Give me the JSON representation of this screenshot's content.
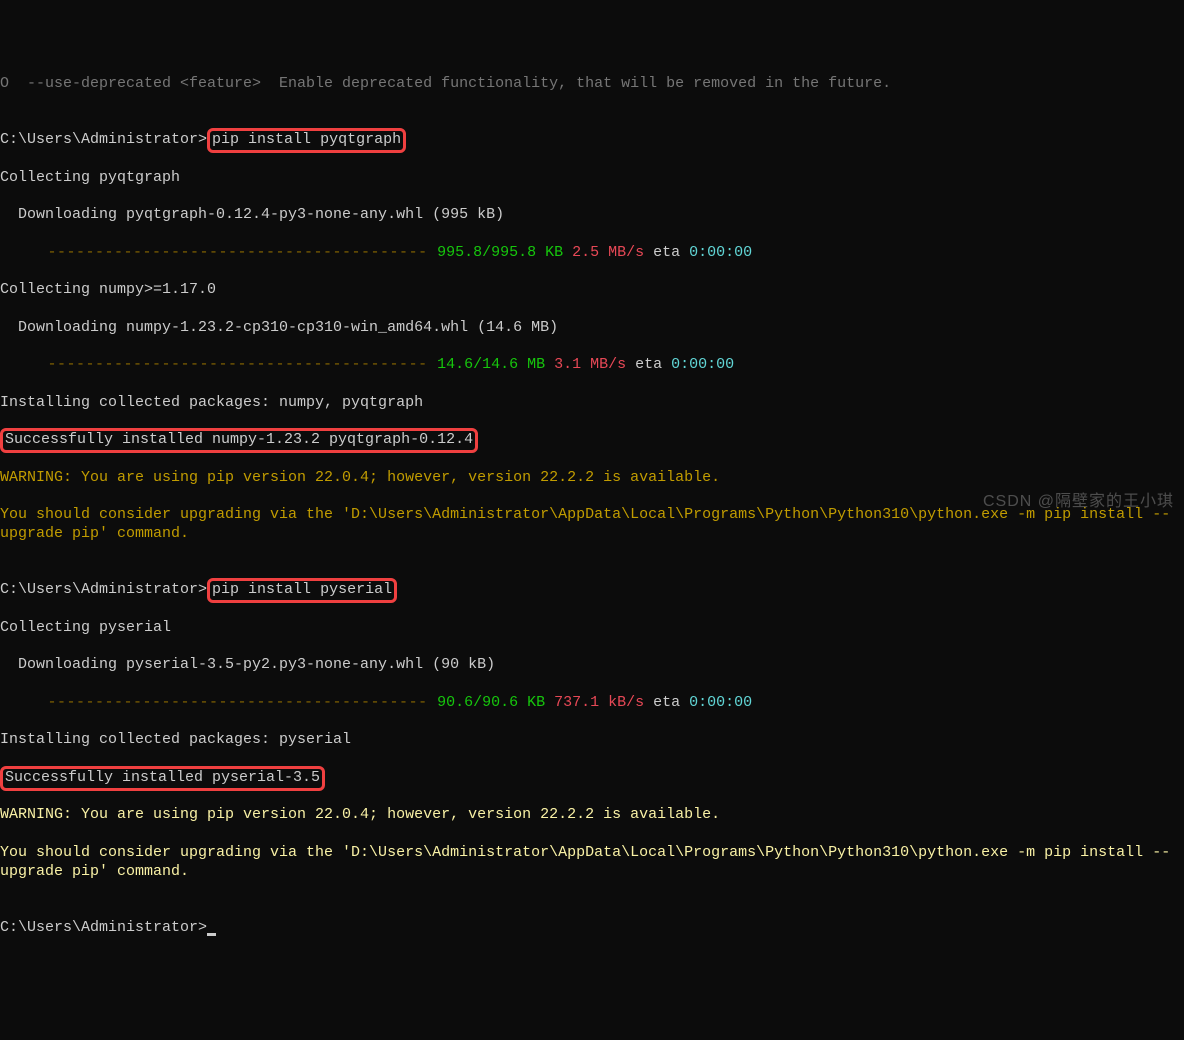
{
  "lines": {
    "top_partial": "O  --use-deprecated <feature>  Enable deprecated functionality, that will be removed in the future.",
    "blank": "",
    "prompt1_prefix": "C:\\Users\\Administrator>",
    "cmd1": "pip install pyqtgraph",
    "collecting1": "Collecting pyqtgraph",
    "dl1": "  Downloading pyqtgraph-0.12.4-py3-none-any.whl (995 kB)",
    "bar1": "     ---------------------------------------- ",
    "bar1_green": "995.8/995.8 KB",
    "bar1_red": " 2.5 MB/s",
    "bar1_eta": " eta ",
    "bar1_time": "0:00:00",
    "collecting2": "Collecting numpy>=1.17.0",
    "dl2": "  Downloading numpy-1.23.2-cp310-cp310-win_amd64.whl (14.6 MB)",
    "bar2": "     ---------------------------------------- ",
    "bar2_green": "14.6/14.6 MB",
    "bar2_red": " 3.1 MB/s",
    "bar2_eta": " eta ",
    "bar2_time": "0:00:00",
    "installing1": "Installing collected packages: numpy, pyqtgraph",
    "success1": "Successfully installed numpy-1.23.2 pyqtgraph-0.12.4",
    "warn1a": "WARNING: You are using pip version 22.0.4; however, version 22.2.2 is available.",
    "warn1b": "You should consider upgrading via the 'D:\\Users\\Administrator\\AppData\\Local\\Programs\\Python\\Python310\\python.exe -m pip install --upgrade pip' command.",
    "prompt2_prefix": "C:\\Users\\Administrator>",
    "cmd2": "pip install pyserial",
    "collecting3": "Collecting pyserial",
    "dl3": "  Downloading pyserial-3.5-py2.py3-none-any.whl (90 kB)",
    "bar3": "     ---------------------------------------- ",
    "bar3_green": "90.6/90.6 KB",
    "bar3_red": " 737.1 kB/s",
    "bar3_eta": " eta ",
    "bar3_time": "0:00:00",
    "installing2": "Installing collected packages: pyserial",
    "success2": "Successfully installed pyserial-3.5",
    "warn2a": "WARNING: You are using pip version 22.0.4; however, version 22.2.2 is available.",
    "warn2b": "You should consider upgrading via the 'D:\\Users\\Administrator\\AppData\\Local\\Programs\\Python\\Python310\\python.exe -m pip install --upgrade pip' command.",
    "prompt3": "C:\\Users\\Administrator>"
  },
  "watermark": "CSDN @隔壁家的王小琪"
}
